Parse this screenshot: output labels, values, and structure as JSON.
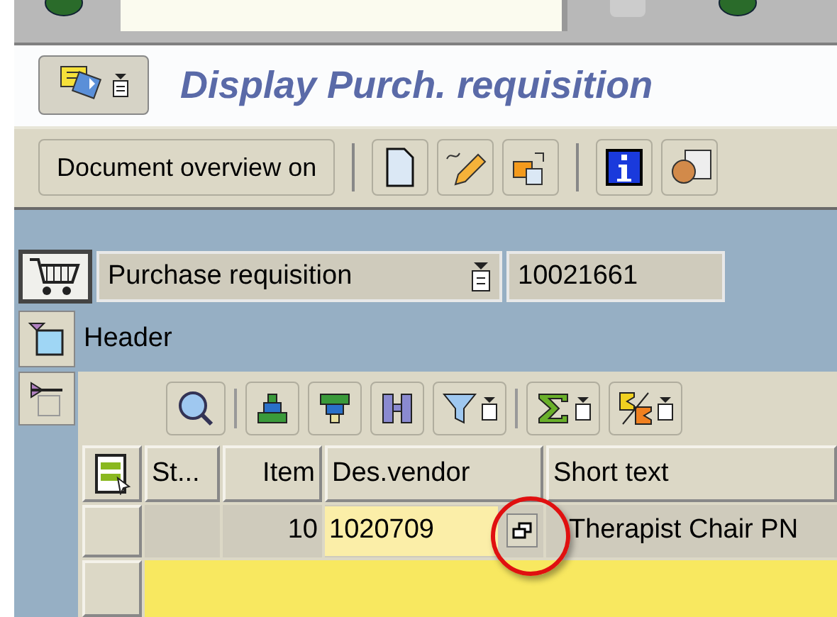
{
  "title": "Display Purch. requisition",
  "toolbar": {
    "button": "Document overview on"
  },
  "document": {
    "type": "Purchase requisition",
    "number": "10021661"
  },
  "section": {
    "label": "Header"
  },
  "table": {
    "columns": [
      "St...",
      "Item",
      "Des.vendor",
      "Short text"
    ],
    "rows": [
      {
        "item": "10",
        "vendor": "1020709",
        "short_text": "Therapist Chair PN"
      }
    ]
  }
}
